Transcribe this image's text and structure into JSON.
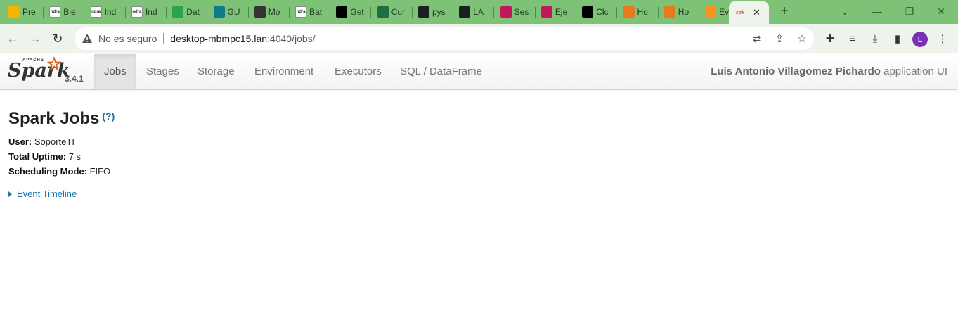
{
  "browser": {
    "tabs": [
      {
        "label": "Pre",
        "icon": "slides-icon",
        "color": "#f4b400"
      },
      {
        "label": "Ble",
        "icon": "indra-icon",
        "color": "#ffffff"
      },
      {
        "label": "Ind",
        "icon": "indra-icon",
        "color": "#ffffff"
      },
      {
        "label": "Ind",
        "icon": "indra-icon",
        "color": "#ffffff"
      },
      {
        "label": "Dat",
        "icon": "drive-icon",
        "color": "#2ba24c"
      },
      {
        "label": "GU",
        "icon": "forms-icon",
        "color": "#0f7b8a"
      },
      {
        "label": "Mo",
        "icon": "spy-icon",
        "color": "#333333"
      },
      {
        "label": "Bat",
        "icon": "indra-icon",
        "color": "#ffffff"
      },
      {
        "label": "Get",
        "icon": "medium-icon",
        "color": "#000000"
      },
      {
        "label": "Cur",
        "icon": "excel-icon",
        "color": "#1d6f42"
      },
      {
        "label": "pys",
        "icon": "github-icon",
        "color": "#1b1f23"
      },
      {
        "label": "LA",
        "icon": "github-icon",
        "color": "#1b1f23"
      },
      {
        "label": "Ses",
        "icon": "play-icon",
        "color": "#c2185b"
      },
      {
        "label": "Eje",
        "icon": "play-icon",
        "color": "#c2185b"
      },
      {
        "label": "Clc",
        "icon": "terminal-icon",
        "color": "#000000"
      },
      {
        "label": "Ho",
        "icon": "loading-icon",
        "color": "#e8791e"
      },
      {
        "label": "Ho",
        "icon": "loading-icon",
        "color": "#e8791e"
      },
      {
        "label": "Eva",
        "icon": "moodle-icon",
        "color": "#f7941e"
      }
    ],
    "active_tab": {
      "icon": "spark-icon",
      "close": "✕"
    },
    "new_tab": "+",
    "security_label": "No es seguro",
    "url_host": "desktop-mbmpc15.lan",
    "url_path": ":4040/jobs/",
    "avatar_letter": "L",
    "avatar_color": "#7b2fb5"
  },
  "spark": {
    "brand_small": "APACHE",
    "brand_name": "Spark",
    "version": "3.4.1",
    "nav": [
      "Jobs",
      "Stages",
      "Storage",
      "Environment",
      "Executors",
      "SQL / DataFrame"
    ],
    "active_nav": "Jobs",
    "app_user": "Luis Antonio Villagomez Pichardo",
    "app_suffix": " application UI"
  },
  "page": {
    "title": "Spark Jobs",
    "help": "(?)",
    "user_label": "User:",
    "user_value": " SoporteTI",
    "uptime_label": "Total Uptime:",
    "uptime_value": " 7 s",
    "sched_label": "Scheduling Mode:",
    "sched_value": " FIFO",
    "timeline_label": "Event Timeline"
  }
}
